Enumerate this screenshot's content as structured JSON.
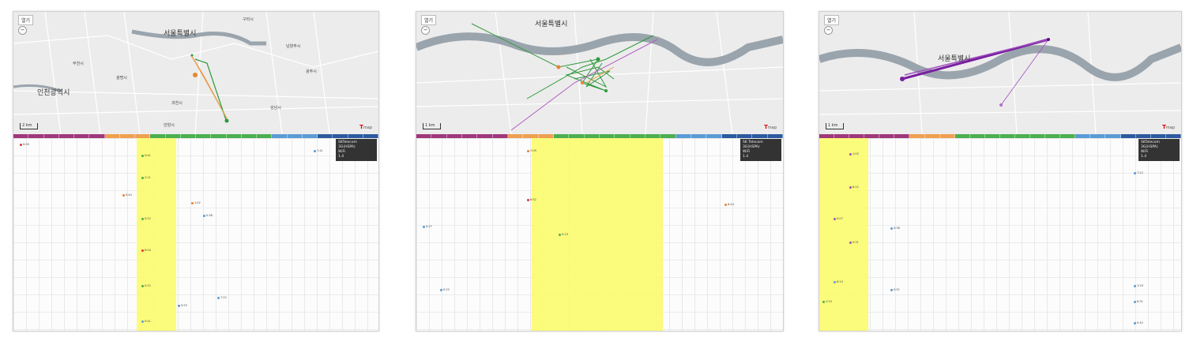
{
  "panels": [
    {
      "map": {
        "open_label": "열기",
        "zoom_label": "−",
        "scale_label": "2 km",
        "brand": "T",
        "brand_sub": "map",
        "labels": [
          "구리시",
          "서울특별시",
          "남양주시",
          "부천시",
          "광명시",
          "인천광역시",
          "과천시",
          "성남시",
          "안양시",
          "광주시"
        ]
      },
      "info_lines": [
        "SKTelecom",
        "3G(HSPA)",
        "WiFi",
        "1.4"
      ],
      "events": [
        "0:09",
        "7:41",
        "0:44",
        "1:02",
        "0:36",
        "7:22",
        "0:53",
        "0:41",
        "2:11",
        "0:22",
        "6:04",
        "0:22",
        "0:41"
      ]
    },
    {
      "map": {
        "open_label": "열기",
        "zoom_label": "−",
        "scale_label": "1 km",
        "brand": "T",
        "brand_sub": "map",
        "labels": [
          "서울특별시"
        ]
      },
      "info_lines": [
        "SK Telecom",
        "3G(HSPA)",
        "WiFi",
        "1.4"
      ],
      "events": [
        "7:09",
        "6:52",
        "0:27",
        "0:22",
        "6:44",
        "0:19"
      ]
    },
    {
      "map": {
        "open_label": "열기",
        "zoom_label": "−",
        "scale_label": "1 km",
        "brand": "T",
        "brand_sub": "map",
        "labels": [
          "서울특별시"
        ]
      },
      "info_lines": [
        "SKTelecom",
        "3G(HSPA)",
        "WiFi",
        "1.4"
      ],
      "events": [
        "1:03",
        "6:12",
        "0:07",
        "0:31",
        "0:36",
        "0:51",
        "6:14",
        "7:22",
        "1:29",
        "6:31",
        "0:42",
        "2:24"
      ]
    }
  ]
}
